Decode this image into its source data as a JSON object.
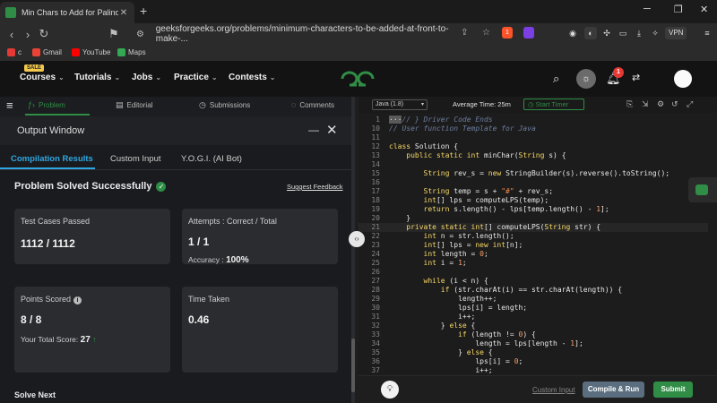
{
  "browser": {
    "tab_title": "Min Chars to Add for Palindrome",
    "tab_close": "✕",
    "new_tab": "+",
    "url": "geeksforgeeks.org/problems/minimum-characters-to-be-added-at-front-to-make-...",
    "vpn_label": "VPN",
    "brave_badge": "1",
    "window_controls": [
      "─",
      "❐",
      "✕"
    ],
    "bookmarks": [
      {
        "label": "c",
        "color": "#e53935"
      },
      {
        "label": "Gmail",
        "color": "#ea4335"
      },
      {
        "label": "YouTube",
        "color": "#ff0000"
      },
      {
        "label": "Maps",
        "color": "#34a853"
      }
    ]
  },
  "header": {
    "sale_badge": "SALE",
    "menu": [
      "Courses",
      "Tutorials",
      "Jobs",
      "Practice",
      "Contests"
    ],
    "notification_count": "1",
    "brand_color": "#2f8d46"
  },
  "left_tabs": [
    {
      "label": "Problem",
      "icon": "code-icon"
    },
    {
      "label": "Editorial",
      "icon": "document-icon"
    },
    {
      "label": "Submissions",
      "icon": "clock-icon"
    },
    {
      "label": "Comments",
      "icon": "comment-icon"
    }
  ],
  "output": {
    "title": "Output Window",
    "tabs": [
      "Compilation Results",
      "Custom Input",
      "Y.O.G.I. (AI Bot)"
    ],
    "status": "Problem Solved Successfully",
    "suggest": "Suggest Feedback",
    "test_cases_label": "Test Cases Passed",
    "test_cases_value": "1112 / 1112",
    "attempts_label": "Attempts : Correct / Total",
    "attempts_value": "1 / 1",
    "accuracy_label": "Accuracy :",
    "accuracy_value": "100%",
    "points_label": "Points Scored",
    "points_value": "8 / 8",
    "total_score_label": "Your Total Score:",
    "total_score_value": "27",
    "time_label": "Time Taken",
    "time_value": "0.46",
    "solve_next": "Solve Next"
  },
  "editor": {
    "language": "Java (1.8)",
    "avg_time": "Average Time: 25m",
    "start_timer": "Start Timer",
    "lines": [
      {
        "n": "1",
        "html": "<span class='fold'>···</span><span class='cm'>// } Driver Code Ends</span>"
      },
      {
        "n": "10",
        "html": "<span class='cm'>// User function Template for Java</span>"
      },
      {
        "n": "11",
        "html": ""
      },
      {
        "n": "12",
        "html": "<span class='kw'>class</span> Solution {"
      },
      {
        "n": "13",
        "html": "    <span class='kw'>public static int</span> minChar(<span class='kw'>String</span> s) {"
      },
      {
        "n": "14",
        "html": ""
      },
      {
        "n": "15",
        "html": "        <span class='kw'>String</span> rev_s = <span class='kw'>new</span> StringBuilder(s).reverse().toString();"
      },
      {
        "n": "16",
        "html": ""
      },
      {
        "n": "17",
        "html": "        <span class='kw'>String</span> temp = s + <span class='str'>\"#\"</span> + rev_s;"
      },
      {
        "n": "18",
        "html": "        <span class='kw'>int</span>[] lps = computeLPS(temp);"
      },
      {
        "n": "19",
        "html": "        <span class='kw'>return</span> s.length() - lps[temp.length() - <span class='num'>1</span>];"
      },
      {
        "n": "20",
        "html": "    }"
      },
      {
        "n": "21",
        "html": "    <span class='kw'>private static int</span>[] computeLPS(<span class='kw'>String</span> str) {"
      },
      {
        "n": "22",
        "html": "        <span class='kw'>int</span> n = str.length();"
      },
      {
        "n": "23",
        "html": "        <span class='kw'>int</span>[] lps = <span class='kw'>new int</span>[n];"
      },
      {
        "n": "24",
        "html": "        <span class='kw'>int</span> length = <span class='num'>0</span>;"
      },
      {
        "n": "25",
        "html": "        <span class='kw'>int</span> i = <span class='num'>1</span>;"
      },
      {
        "n": "26",
        "html": ""
      },
      {
        "n": "27",
        "html": "        <span class='kw'>while</span> (i &lt; n) {"
      },
      {
        "n": "28",
        "html": "            <span class='kw'>if</span> (str.charAt(i) == str.charAt(length)) {"
      },
      {
        "n": "29",
        "html": "                length++;"
      },
      {
        "n": "30",
        "html": "                lps[i] = length;"
      },
      {
        "n": "31",
        "html": "                i++;"
      },
      {
        "n": "32",
        "html": "            } <span class='kw'>else</span> {"
      },
      {
        "n": "33",
        "html": "                <span class='kw'>if</span> (length != <span class='num'>0</span>) {"
      },
      {
        "n": "34",
        "html": "                    length = lps[length - <span class='num'>1</span>];"
      },
      {
        "n": "35",
        "html": "                } <span class='kw'>else</span> {"
      },
      {
        "n": "36",
        "html": "                    lps[i] = <span class='num'>0</span>;"
      },
      {
        "n": "37",
        "html": "                    i++;"
      }
    ]
  },
  "actions": {
    "custom_input": "Custom Input",
    "compile_run": "Compile & Run",
    "submit": "Submit"
  }
}
